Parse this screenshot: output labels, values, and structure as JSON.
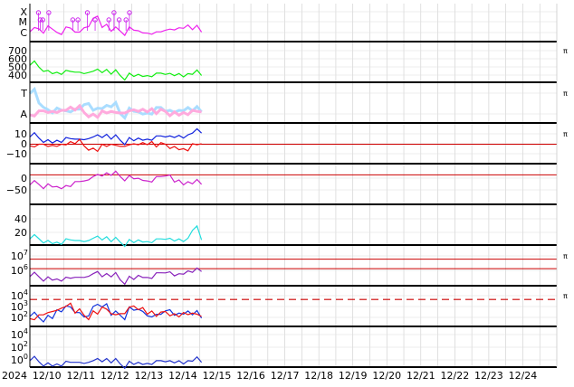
{
  "chart_data": {
    "type": "line",
    "grid": true,
    "x_axis": {
      "year_label": "2024",
      "tick_labels": [
        "12/10",
        "12/11",
        "12/12",
        "12/13",
        "12/14",
        "12/15",
        "12/16",
        "12/17",
        "12/18",
        "12/19",
        "12/20",
        "12/21",
        "12/22",
        "12/23",
        "12/24"
      ],
      "data_end": "12/14 ~12:00"
    },
    "panels": [
      {
        "id": "xray-flares",
        "tick_labels": [
          "X",
          "M",
          "C"
        ],
        "series": [
          {
            "color": "#ee22ee",
            "values": [
              0.1,
              0.25,
              0.4,
              0.2,
              0.3,
              0.15,
              0.35,
              0.6,
              0.3,
              0.2,
              0.25,
              0.3,
              0.2,
              0.15,
              0.1,
              0.2,
              0.25,
              0.35,
              0.2,
              0.15
            ]
          }
        ],
        "markers": {
          "color": "#cc22ee",
          "positions": [
            0.05,
            0.06,
            0.075,
            0.11,
            0.25,
            0.28,
            0.335,
            0.38,
            0.46,
            0.49,
            0.52,
            0.56,
            0.58
          ]
        },
        "right_label": ""
      },
      {
        "id": "solar-wind-speed",
        "tick_labels": [
          "700",
          "600",
          "500",
          "400"
        ],
        "ylim": [
          300,
          750
        ],
        "series": [
          {
            "color": "#11ee11",
            "values": [
              470,
              460,
              430,
              420,
              410,
              400,
              395,
              390,
              385,
              380,
              375,
              372,
              370,
              368,
              365,
              362,
              360,
              358,
              356,
              355
            ]
          }
        ],
        "right_label": "π"
      },
      {
        "id": "composition",
        "tick_labels": [
          "T",
          "A"
        ],
        "series": [
          {
            "color": "#aaddff",
            "values": [
              0.8,
              0.5,
              0.3,
              0.4,
              0.2,
              0.3,
              0.5,
              0.2,
              0.3,
              0.4,
              0.2,
              0.3,
              0.2,
              0.2,
              0.3,
              0.2,
              0.2,
              0.3,
              0.2,
              0.2
            ]
          },
          {
            "color": "#ffaadd",
            "values": [
              0.15,
              0.2,
              0.18,
              0.22,
              0.2,
              0.25,
              0.2,
              0.18,
              0.2,
              0.22,
              0.2,
              0.18,
              0.2,
              0.22,
              0.2,
              0.18,
              0.2,
              0.22,
              0.2,
              0.18
            ]
          }
        ],
        "right_label": "π"
      },
      {
        "id": "imf-bz-bt",
        "tick_labels": [
          "10",
          "0",
          "−10"
        ],
        "ylim": [
          -15,
          15
        ],
        "reference_line": 0,
        "series": [
          {
            "color": "#1122dd",
            "values": [
              5,
              5,
              4.5,
              5,
              5,
              4.5,
              5,
              5,
              5.5,
              5,
              5,
              5,
              5.5,
              5.5,
              6,
              6,
              6.5,
              7,
              9,
              10
            ]
          },
          {
            "color": "#ee1111",
            "values": [
              0,
              -1,
              -2,
              -1,
              -2,
              0,
              -1,
              -2,
              -1,
              0,
              -1,
              -2,
              -1,
              0,
              -1,
              -1,
              -2,
              -3,
              -1,
              0
            ]
          }
        ],
        "right_label": "π"
      },
      {
        "id": "imf-angle",
        "tick_labels": [
          "0",
          "−50"
        ],
        "ylim": [
          -80,
          20
        ],
        "reference_line": 0,
        "series": [
          {
            "color": "#cc22cc",
            "values": [
              -35,
              -30,
              -25,
              -30,
              -35,
              -20,
              -15,
              -10,
              -5,
              0,
              0,
              -5,
              -10,
              -15,
              -10,
              -5,
              -20,
              -25,
              -30,
              -28
            ]
          }
        ],
        "right_label": ""
      },
      {
        "id": "density",
        "tick_labels": [
          "40",
          "20"
        ],
        "ylim": [
          0,
          55
        ],
        "series": [
          {
            "color": "#22dddd",
            "values": [
              3,
              5,
              4,
              3,
              4,
              3,
              3,
              4,
              3,
              2,
              3,
              3,
              4,
              3,
              3,
              4,
              3,
              4,
              18,
              4
            ]
          }
        ],
        "right_label": ""
      },
      {
        "id": "proton-flux",
        "tick_labels": [
          "10^7",
          "10^6"
        ],
        "reference_lines": [
          7,
          6
        ],
        "ylim": [
          4.5,
          8
        ],
        "series": [
          {
            "color": "#8822bb",
            "values": [
              5.0,
              5.1,
              5.2,
              5.1,
              5.0,
              5.1,
              5.2,
              5.3,
              5.1,
              5.2,
              5.0,
              5.1,
              5.3,
              5.2,
              5.4,
              5.5,
              5.3,
              5.6,
              5.5,
              5.7
            ]
          }
        ],
        "right_label": "π"
      },
      {
        "id": "electron-flux",
        "tick_labels": [
          "10^4",
          "10^3",
          "10^2"
        ],
        "dashed_threshold": 4,
        "ylim": [
          1.5,
          4.5
        ],
        "series": [
          {
            "color": "#1133dd",
            "values": [
              2.0,
              2.0,
              2.3,
              2.9,
              3.0,
              2.5,
              2.2,
              2.9,
              2.95,
              2.3,
              2.4,
              2.9,
              2.8,
              2.3,
              2.2,
              2.6,
              2.3,
              2.5,
              2.2,
              2.0
            ]
          },
          {
            "color": "#ee1111",
            "values": [
              2.1,
              2.2,
              2.5,
              2.8,
              2.9,
              2.4,
              2.3,
              2.8,
              2.9,
              2.4,
              2.5,
              2.85,
              2.7,
              2.4,
              2.3,
              2.5,
              2.4,
              2.6,
              2.3,
              2.1
            ]
          }
        ],
        "right_label": "π"
      },
      {
        "id": "bottom-flux",
        "tick_labels": [
          "10^4",
          "10^2",
          "10^0"
        ],
        "ylim": [
          -1.5,
          5
        ],
        "series": [
          {
            "color": "#2233cc",
            "values": [
              -1.1,
              -1.1,
              -1.1,
              -1.1,
              -1.1,
              -1.1,
              -1.1,
              -1.1,
              -1.1,
              -1.1,
              -1.1,
              -1.1,
              -1.1,
              -1.1,
              -1.1,
              -1.1,
              -1.1,
              -1.1,
              -1.1,
              -1.1
            ]
          }
        ],
        "right_label": ""
      }
    ]
  }
}
